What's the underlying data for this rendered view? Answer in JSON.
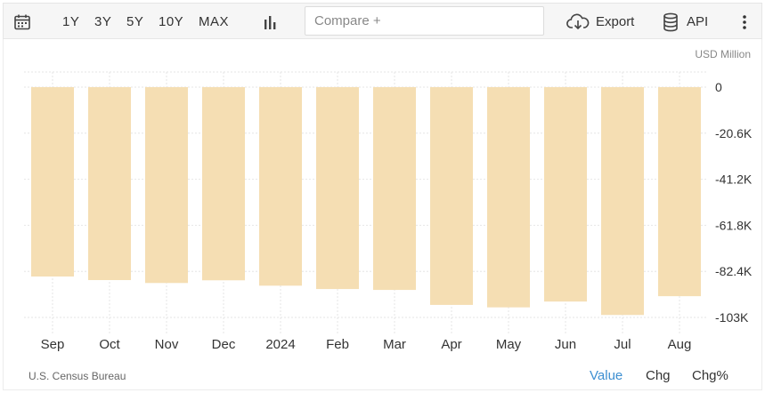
{
  "toolbar": {
    "ranges": [
      "1Y",
      "3Y",
      "5Y",
      "10Y",
      "MAX"
    ],
    "compare_placeholder": "Compare +",
    "export_label": "Export",
    "api_label": "API",
    "icons": [
      "calendar-icon",
      "bar-chart-icon",
      "cloud-download-icon",
      "database-icon",
      "more-vertical-icon"
    ]
  },
  "chart": {
    "unit": "USD Million",
    "source": "U.S. Census Bureau",
    "modes": [
      "Value",
      "Chg",
      "Chg%"
    ],
    "active_mode": "Value",
    "colors": {
      "bar": "#f5deb3",
      "grid": "#e6e6e6",
      "tick": "#333333"
    }
  },
  "chart_data": {
    "type": "bar",
    "categories": [
      "Sep",
      "Oct",
      "Nov",
      "Dec",
      "2024",
      "Feb",
      "Mar",
      "Apr",
      "May",
      "Jun",
      "Jul",
      "Aug"
    ],
    "values": [
      -84700,
      -86300,
      -87600,
      -86400,
      -88800,
      -90300,
      -90700,
      -97400,
      -98500,
      -95900,
      -101900,
      -93500
    ],
    "y_ticks": [
      0,
      -20600,
      -41200,
      -61800,
      -82400,
      -103000
    ],
    "y_tick_labels": [
      "0",
      "-20.6K",
      "-41.2K",
      "-61.8K",
      "-82.4K",
      "-103K"
    ],
    "ylim": [
      -103000,
      0
    ],
    "grid": true
  }
}
